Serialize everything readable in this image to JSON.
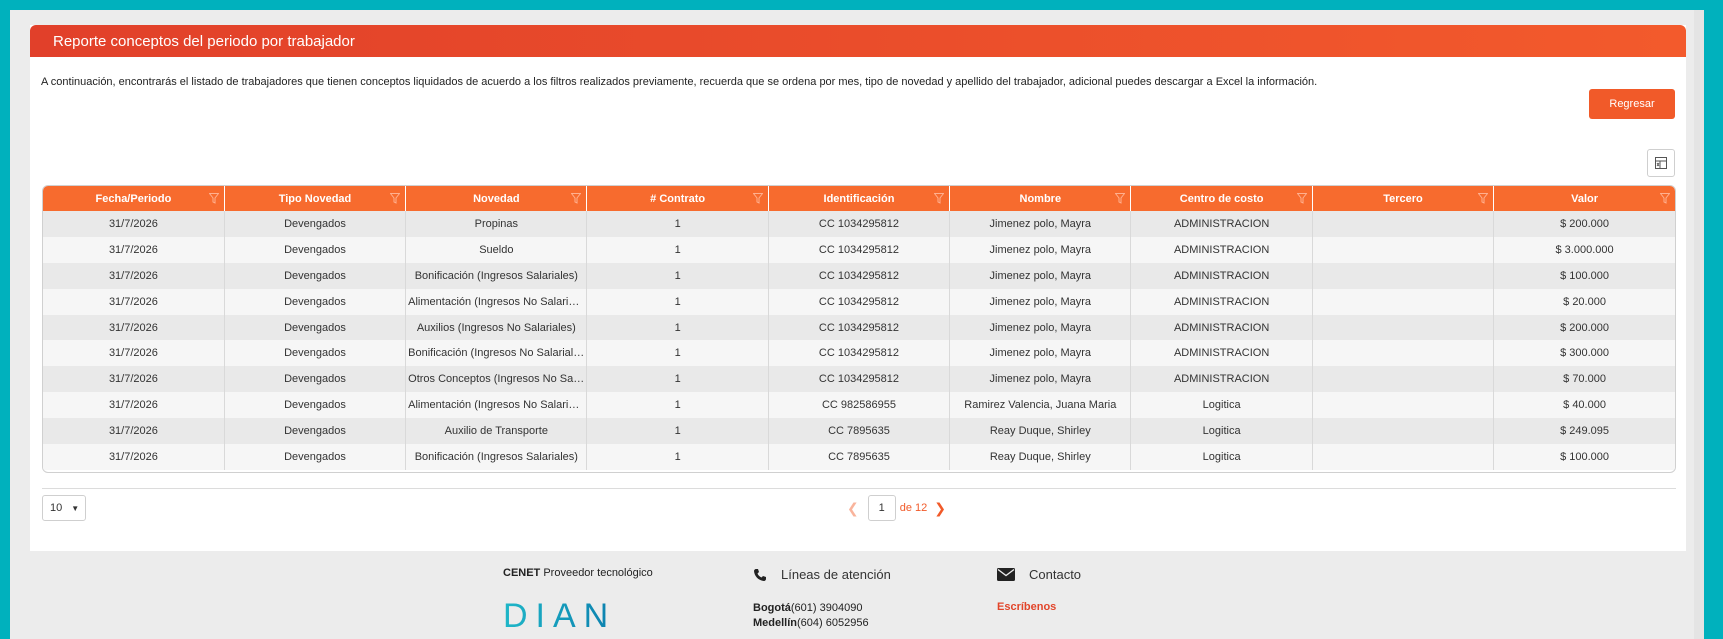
{
  "header": {
    "title": "Reporte conceptos del periodo por trabajador"
  },
  "intro": "A continuación, encontrarás el listado de trabajadores que tienen conceptos liquidados de acuerdo a los filtros realizados previamente, recuerda que se ordena por mes, tipo de novedad y apellido del trabajador, adicional puedes descargar a Excel la información.",
  "actions": {
    "back_label": "Regresar",
    "excel_icon": "excel-export-icon"
  },
  "table": {
    "columns": [
      "Fecha/Periodo",
      "Tipo Novedad",
      "Novedad",
      "# Contrato",
      "Identificación",
      "Nombre",
      "Centro de costo",
      "Tercero",
      "Valor"
    ],
    "rows": [
      [
        "31/7/2026",
        "Devengados",
        "Propinas",
        "1",
        "CC 1034295812",
        "Jimenez polo, Mayra",
        "ADMINISTRACION",
        "",
        "$ 200.000"
      ],
      [
        "31/7/2026",
        "Devengados",
        "Sueldo",
        "1",
        "CC 1034295812",
        "Jimenez polo, Mayra",
        "ADMINISTRACION",
        "",
        "$ 3.000.000"
      ],
      [
        "31/7/2026",
        "Devengados",
        "Bonificación (Ingresos Salariales)",
        "1",
        "CC 1034295812",
        "Jimenez polo, Mayra",
        "ADMINISTRACION",
        "",
        "$ 100.000"
      ],
      [
        "31/7/2026",
        "Devengados",
        "Alimentación (Ingresos No Salarial...",
        "1",
        "CC 1034295812",
        "Jimenez polo, Mayra",
        "ADMINISTRACION",
        "",
        "$ 20.000"
      ],
      [
        "31/7/2026",
        "Devengados",
        "Auxilios (Ingresos No Salariales)",
        "1",
        "CC 1034295812",
        "Jimenez polo, Mayra",
        "ADMINISTRACION",
        "",
        "$ 200.000"
      ],
      [
        "31/7/2026",
        "Devengados",
        "Bonificación (Ingresos No Salariales)",
        "1",
        "CC 1034295812",
        "Jimenez polo, Mayra",
        "ADMINISTRACION",
        "",
        "$ 300.000"
      ],
      [
        "31/7/2026",
        "Devengados",
        "Otros Conceptos (Ingresos No Sala...",
        "1",
        "CC 1034295812",
        "Jimenez polo, Mayra",
        "ADMINISTRACION",
        "",
        "$ 70.000"
      ],
      [
        "31/7/2026",
        "Devengados",
        "Alimentación (Ingresos No Salarial...",
        "1",
        "CC 982586955",
        "Ramirez Valencia, Juana Maria",
        "Logitica",
        "",
        "$ 40.000"
      ],
      [
        "31/7/2026",
        "Devengados",
        "Auxilio de Transporte",
        "1",
        "CC 7895635",
        "Reay Duque, Shirley",
        "Logitica",
        "",
        "$ 249.095"
      ],
      [
        "31/7/2026",
        "Devengados",
        "Bonificación (Ingresos Salariales)",
        "1",
        "CC 7895635",
        "Reay Duque, Shirley",
        "Logitica",
        "",
        "$ 100.000"
      ]
    ]
  },
  "pagination": {
    "page_size": "10",
    "current_page": "1",
    "of_label": "de",
    "total_pages": "12"
  },
  "footer": {
    "provider_bold": "CENET",
    "provider_text": " Proveedor tecnológico",
    "logo_text": "DIAN",
    "lines_title": "Líneas de atención",
    "phones": [
      {
        "city": "Bogotá",
        "number": "(601) 3904090"
      },
      {
        "city": "Medellín",
        "number": "(604) 6052956"
      }
    ],
    "contact_title": "Contacto",
    "write_us": "Escríbenos"
  },
  "colors": {
    "accent": "#f15a29",
    "header_start": "#e1402a",
    "frame": "#00b1bd",
    "dian_blue": "#0b7fae"
  }
}
